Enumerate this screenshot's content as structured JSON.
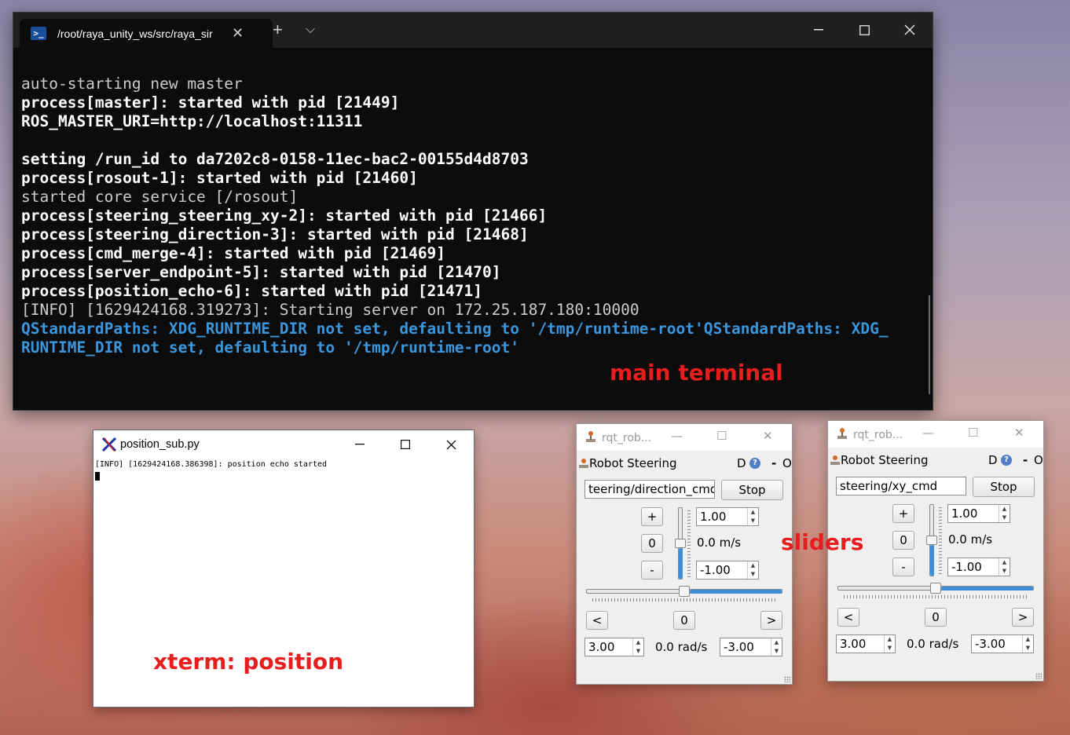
{
  "terminal": {
    "tab_title": "/root/raya_unity_ws/src/raya_sir",
    "tab_icon": "powershell-icon",
    "lines": [
      {
        "text": "auto-starting new master",
        "style": "gray"
      },
      {
        "text": "process[master]: started with pid [21449]",
        "style": "white"
      },
      {
        "text": "ROS_MASTER_URI=http://localhost:11311",
        "style": "white"
      },
      {
        "text": "",
        "style": "white"
      },
      {
        "text": "setting /run_id to da7202c8-0158-11ec-bac2-00155d4d8703",
        "style": "white"
      },
      {
        "text": "process[rosout-1]: started with pid [21460]",
        "style": "white"
      },
      {
        "text": "started core service [/rosout]",
        "style": "gray"
      },
      {
        "text": "process[steering_steering_xy-2]: started with pid [21466]",
        "style": "white"
      },
      {
        "text": "process[steering_direction-3]: started with pid [21468]",
        "style": "white"
      },
      {
        "text": "process[cmd_merge-4]: started with pid [21469]",
        "style": "white"
      },
      {
        "text": "process[server_endpoint-5]: started with pid [21470]",
        "style": "white"
      },
      {
        "text": "process[position_echo-6]: started with pid [21471]",
        "style": "white"
      },
      {
        "text": "[INFO] [1629424168.319273]: Starting server on 172.25.187.180:10000",
        "style": "gray"
      },
      {
        "text": "QStandardPaths: XDG_RUNTIME_DIR not set, defaulting to '/tmp/runtime-root'QStandardPaths: XDG_",
        "style": "blue"
      },
      {
        "text": "RUNTIME_DIR not set, defaulting to '/tmp/runtime-root'",
        "style": "blue"
      }
    ],
    "colors": {
      "bg": "#0c0c0c",
      "blue": "#3a96dd"
    }
  },
  "annotations": {
    "main_terminal": "main terminal",
    "sliders": "sliders",
    "xterm_position": "xterm: position"
  },
  "xterm": {
    "title": "position_sub.py",
    "line": "[INFO] [1629424168.386398]: position echo started"
  },
  "rqt_left": {
    "title": "rqt_rob...",
    "plugin_name": "Robot Steering",
    "d_label": "D",
    "help_label": "?",
    "dash_label": "-",
    "o_label": "O",
    "topic": "teering/direction_cmd",
    "stop_label": "Stop",
    "plus_label": "+",
    "zero_label": "0",
    "minus_label": "-",
    "max_linear": "1.00",
    "linear_value": "0.0 m/s",
    "min_linear": "-1.00",
    "left_label": "<",
    "center_label": "0",
    "right_label": ">",
    "max_angular": "3.00",
    "angular_value": "0.0 rad/s",
    "min_angular": "-3.00",
    "linear_level": 0.5,
    "angular_level": 0.5
  },
  "rqt_right": {
    "title": "rqt_rob...",
    "plugin_name": "Robot Steering",
    "d_label": "D",
    "help_label": "?",
    "dash_label": "-",
    "o_label": "O",
    "topic": "steering/xy_cmd",
    "stop_label": "Stop",
    "plus_label": "+",
    "zero_label": "0",
    "minus_label": "-",
    "max_linear": "1.00",
    "linear_value": "0.0 m/s",
    "min_linear": "-1.00",
    "left_label": "<",
    "center_label": "0",
    "right_label": ">",
    "max_angular": "3.00",
    "angular_value": "0.0 rad/s",
    "min_angular": "-3.00",
    "linear_level": 0.5,
    "angular_level": 0.5
  }
}
